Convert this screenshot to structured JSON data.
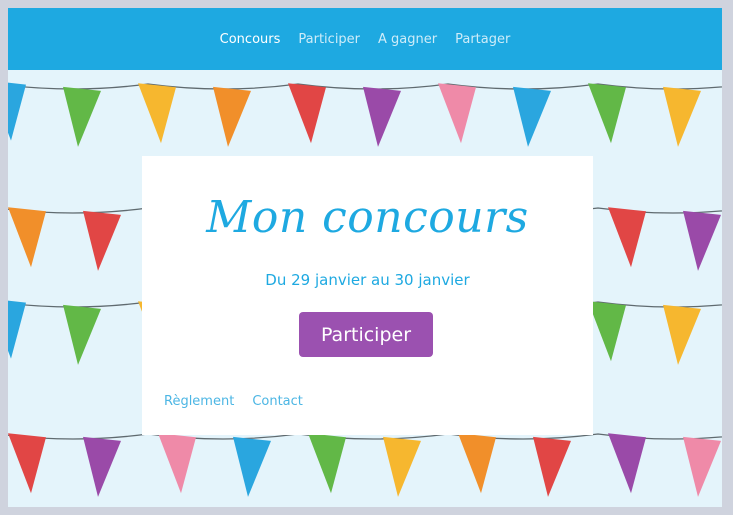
{
  "nav": {
    "items": [
      {
        "label": "Concours",
        "active": true
      },
      {
        "label": "Participer",
        "active": false
      },
      {
        "label": "A gagner",
        "active": false
      },
      {
        "label": "Partager",
        "active": false
      }
    ]
  },
  "card": {
    "title": "Mon concours",
    "dates": "Du 29 janvier au 30 janvier",
    "button_label": "Participer",
    "footer_links": [
      "Règlement",
      "Contact"
    ]
  },
  "colors": {
    "nav_background": "#1ea9e1",
    "page_background": "#e4f4fb",
    "accent_text": "#1ea9e1",
    "button_background": "#9b51b0",
    "footer_link": "#4cb6e4",
    "flags": [
      "#2aa6df",
      "#62b847",
      "#f6b72f",
      "#f18f2a",
      "#e14645",
      "#9a4aa8",
      "#ef8aa8"
    ]
  }
}
